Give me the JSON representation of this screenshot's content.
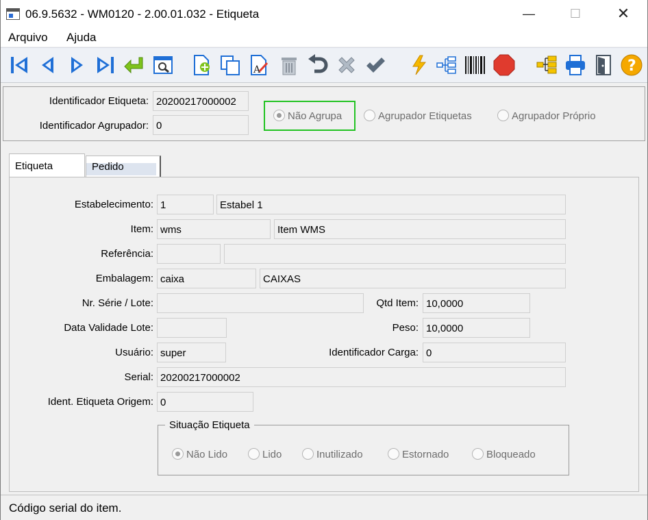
{
  "window": {
    "title": "06.9.5632 - WM0120 - 2.00.01.032 - Etiqueta"
  },
  "menu": {
    "items": [
      "Arquivo",
      "Ajuda"
    ]
  },
  "toolbar": {
    "icons": [
      "first-icon",
      "previous-icon",
      "next-icon",
      "last-icon",
      "goto-icon",
      "search-icon",
      "add-icon",
      "copy-icon",
      "edit-icon",
      "delete-icon",
      "undo-icon",
      "cancel-icon",
      "confirm-icon",
      "lightning-icon",
      "tree-icon",
      "barcode-icon",
      "stop-icon",
      "hierarchy-icon",
      "print-icon",
      "exit-icon",
      "help-icon"
    ]
  },
  "header": {
    "id_label": "Identificador Etiqueta:",
    "id_value": "20200217000002",
    "group_label": "Identificador Agrupador:",
    "group_value": "0",
    "radios": [
      {
        "label": "Não Agrupa",
        "checked": true
      },
      {
        "label": "Agrupador Etiquetas",
        "checked": false
      },
      {
        "label": "Agrupador Próprio",
        "checked": false
      }
    ]
  },
  "tabs": [
    {
      "label": "Etiqueta"
    },
    {
      "label": "Pedido"
    }
  ],
  "form": {
    "estabelecimento": {
      "label": "Estabelecimento:",
      "code": "1",
      "desc": "Estabel 1"
    },
    "item": {
      "label": "Item:",
      "code": "wms",
      "desc": "Item WMS"
    },
    "referencia": {
      "label": "Referência:",
      "code": "",
      "desc": ""
    },
    "embalagem": {
      "label": "Embalagem:",
      "code": "caixa",
      "desc": "CAIXAS"
    },
    "serie_lote": {
      "label": "Nr. Série / Lote:",
      "value": ""
    },
    "qtd_item": {
      "label": "Qtd Item:",
      "value": "10,0000"
    },
    "data_validade": {
      "label": "Data Validade Lote:",
      "value": ""
    },
    "peso": {
      "label": "Peso:",
      "value": "10,0000"
    },
    "usuario": {
      "label": "Usuário:",
      "value": "super"
    },
    "carga": {
      "label": "Identificador Carga:",
      "value": "0"
    },
    "serial": {
      "label": "Serial:",
      "value": "20200217000002"
    },
    "origem": {
      "label": "Ident. Etiqueta Origem:",
      "value": "0"
    }
  },
  "situacao": {
    "title": "Situação Etiqueta",
    "options": [
      {
        "label": "Não Lido",
        "checked": true
      },
      {
        "label": "Lido",
        "checked": false
      },
      {
        "label": "Inutilizado",
        "checked": false
      },
      {
        "label": "Estornado",
        "checked": false
      },
      {
        "label": "Bloqueado",
        "checked": false
      }
    ]
  },
  "status": {
    "text": "Código serial do item."
  },
  "colors": {
    "focus": "#22c322",
    "nav_blue": "#1f6fd6",
    "stop_red": "#e03b2e",
    "help_orange": "#f5a800"
  }
}
